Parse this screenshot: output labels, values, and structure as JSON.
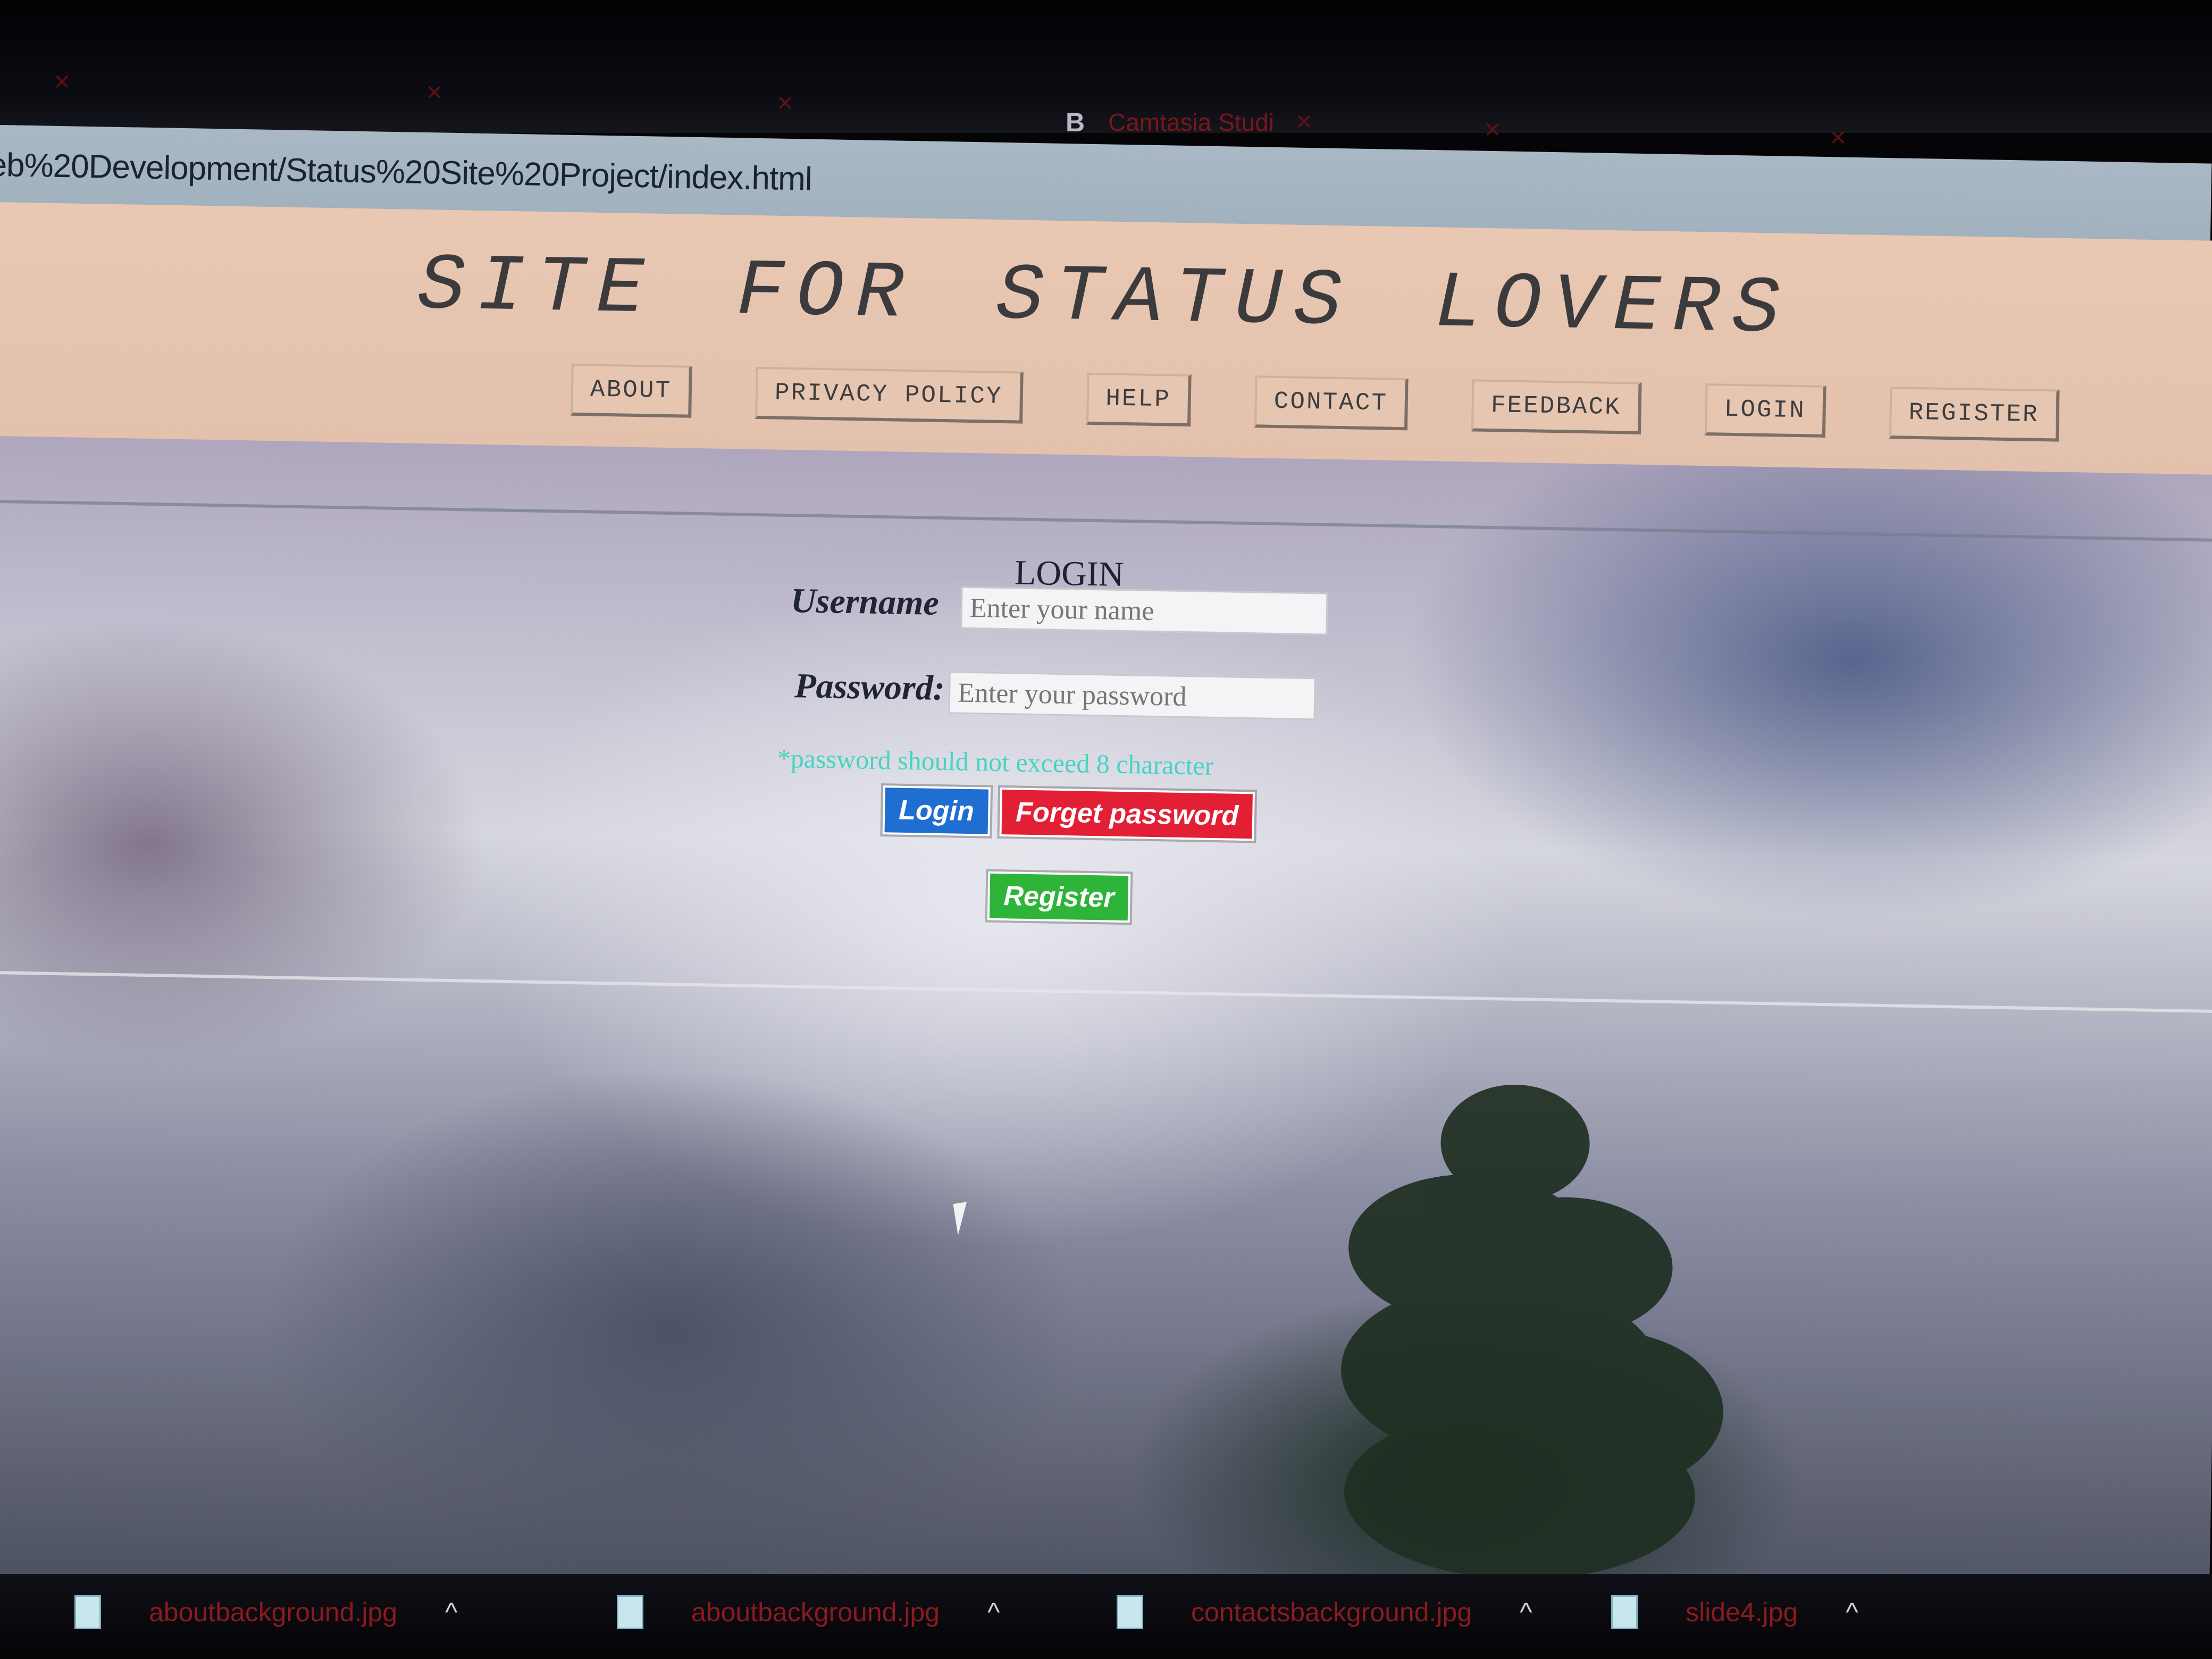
{
  "browser": {
    "tabs": [
      {
        "label": "",
        "active": false
      },
      {
        "label": "",
        "active": false
      },
      {
        "label": "",
        "active": false
      },
      {
        "label": "Camtasia Studi",
        "active": true,
        "favicon": "B"
      },
      {
        "label": "",
        "active": false
      },
      {
        "label": "",
        "active": false
      }
    ],
    "url": "eb%20Development/Status%20Site%20Project/index.html"
  },
  "site": {
    "title": "SITE FOR STATUS LOVERS",
    "nav": [
      "ABOUT",
      "PRIVACY POLICY",
      "HELP",
      "CONTACT",
      "FEEDBACK",
      "LOGIN",
      "REGISTER"
    ]
  },
  "login": {
    "title": "LOGIN",
    "username_label": "Username",
    "username_placeholder": "Enter your name",
    "password_label": "Password:",
    "password_placeholder": "Enter your password",
    "hint": "*password should not exceed 8 character",
    "login_button": "Login",
    "forget_button": "Forget password",
    "register_button": "Register"
  },
  "downloads": {
    "items": [
      {
        "name": "aboutbackground.jpg"
      },
      {
        "name": "aboutbackground.jpg"
      },
      {
        "name": "contactsbackground.jpg"
      },
      {
        "name": "slide4.jpg"
      }
    ]
  },
  "colors": {
    "header_bg": "#e9c8b3",
    "login_button": "#1f6ed1",
    "forget_button": "#e31f36",
    "register_button": "#2fb43a",
    "hint_text": "#35d4c0"
  }
}
